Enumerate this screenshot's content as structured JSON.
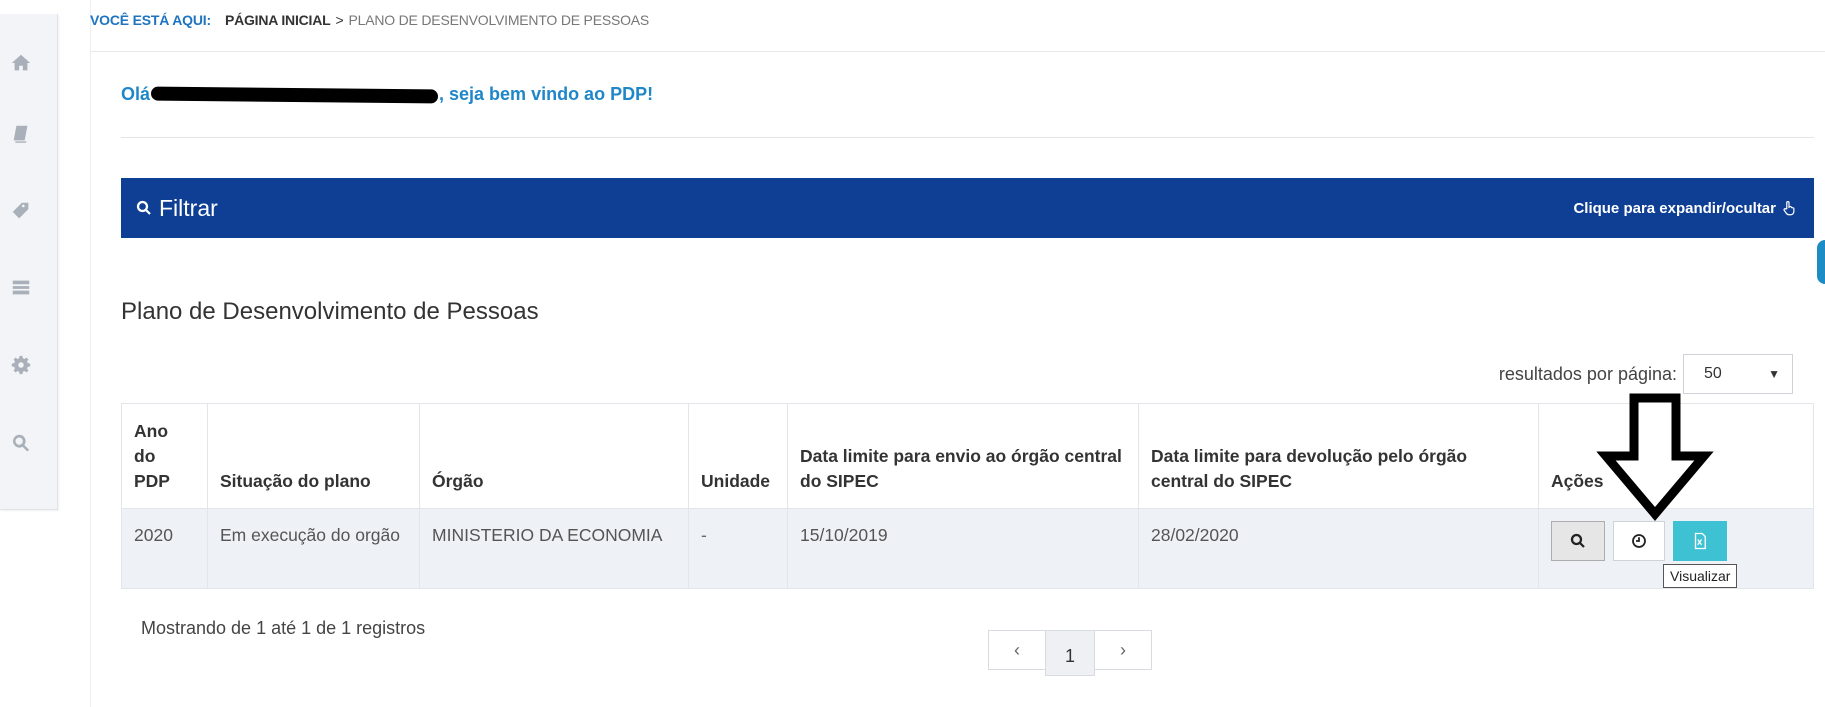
{
  "breadcrumb": {
    "lead": "VOCÊ ESTÁ AQUI:",
    "home": "PÁGINA INICIAL",
    "separator": ">",
    "current": "PLANO DE DESENVOLVIMENTO DE PESSOAS"
  },
  "sidebar": {
    "items": [
      {
        "icon": "home-icon"
      },
      {
        "icon": "book-icon"
      },
      {
        "icon": "tag-icon"
      },
      {
        "icon": "list-icon"
      },
      {
        "icon": "gear-icon"
      },
      {
        "icon": "search-icon"
      }
    ]
  },
  "greeting": {
    "prefix": "Olá",
    "suffix": ", seja bem vindo ao PDP!"
  },
  "filter": {
    "title": "Filtrar",
    "toggle_label": "Clique para expandir/ocultar"
  },
  "section": {
    "title": "Plano de Desenvolvimento de Pessoas"
  },
  "page_size": {
    "label": "resultados por página:",
    "selected": "50"
  },
  "table": {
    "headers": {
      "ano": "Ano do PDP",
      "situacao": "Situação do plano",
      "orgao": "Órgão",
      "unidade": "Unidade",
      "data_envio": "Data limite para envio ao órgão central do SIPEC",
      "data_devolucao": "Data limite para devolução pelo órgão central do SIPEC",
      "acoes": "Ações"
    },
    "rows": [
      {
        "ano": "2020",
        "situacao": "Em execução do orgão",
        "orgao": "MINISTERIO DA ECONOMIA",
        "unidade": "-",
        "data_envio": "15/10/2019",
        "data_devolucao": "28/02/2020"
      }
    ]
  },
  "tooltip": {
    "text": "Visualizar"
  },
  "footer": {
    "records_info": "Mostrando de 1 até 1 de 1 registros",
    "pagination": {
      "prev": "‹",
      "current": "1",
      "next": "›"
    }
  },
  "colors": {
    "filter_bar": "#0f3f94",
    "greeting": "#1f86c8",
    "excel_button": "#3ec2d3"
  }
}
